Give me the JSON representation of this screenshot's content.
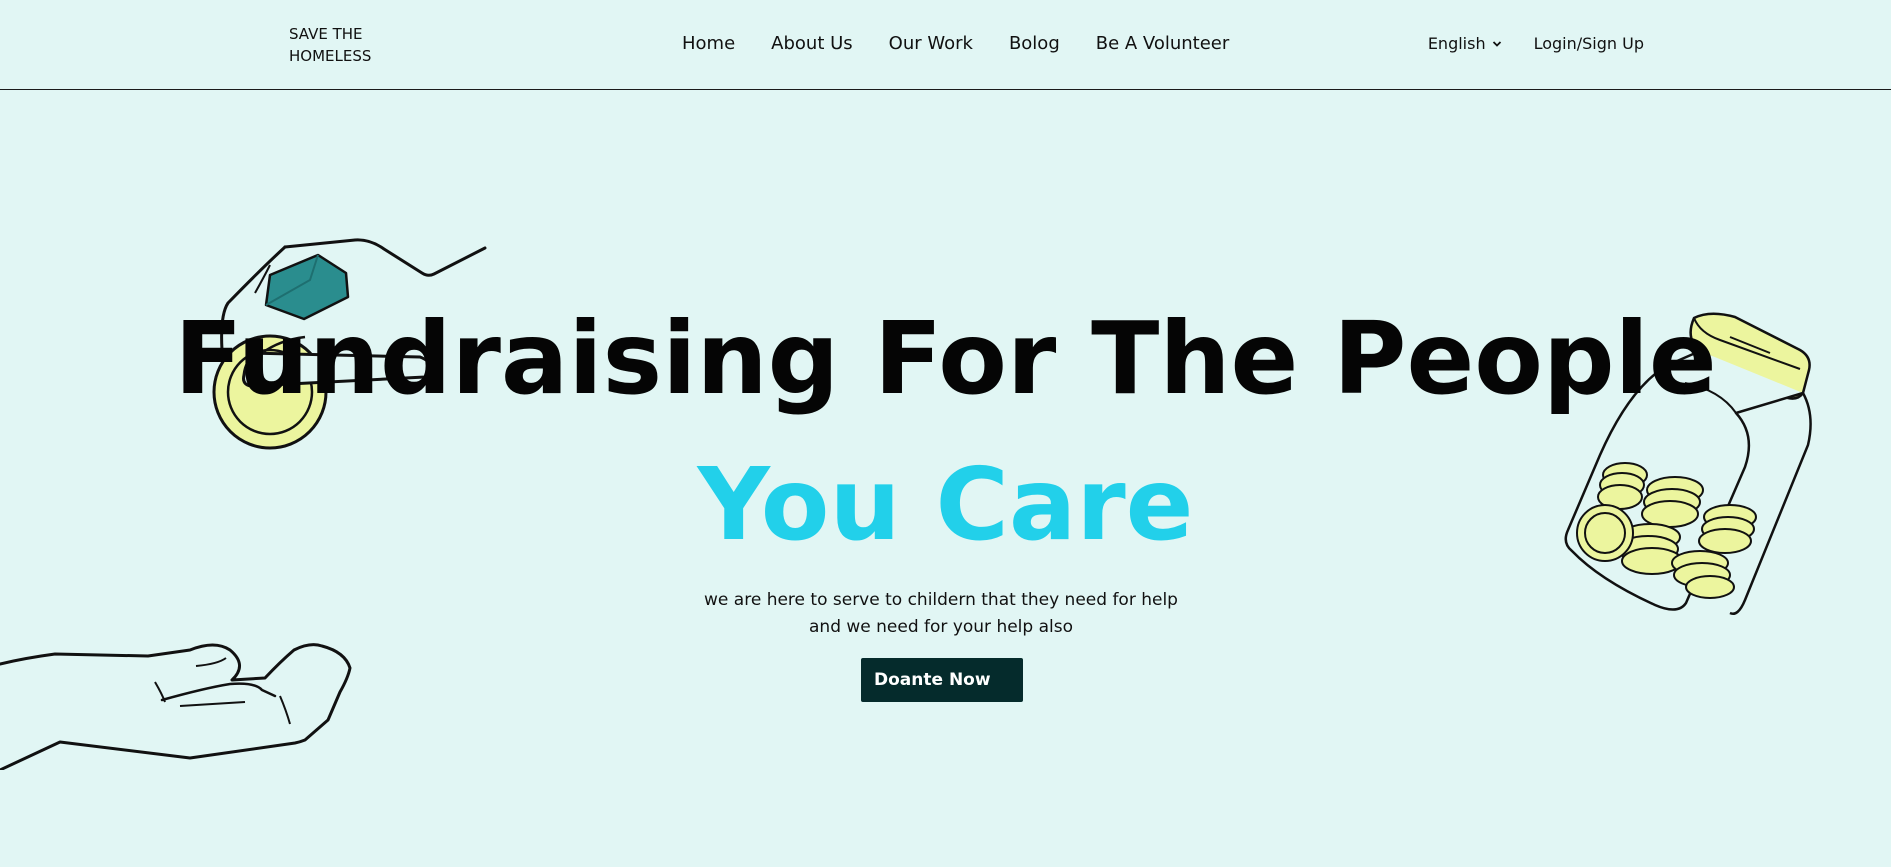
{
  "header": {
    "brand": "SAVE THE HOMELESS",
    "nav": [
      "Home",
      "About Us",
      "Our Work",
      "Bolog",
      "Be A Volunteer"
    ],
    "language": "English",
    "login": "Login/Sign Up"
  },
  "hero": {
    "title": "Fundraising For The People",
    "accent": "You Care",
    "subtitle": "we are here to serve to childern that they need for help and we need for your help also",
    "cta": "Doante Now"
  },
  "colors": {
    "background": "#e1f6f4",
    "accent": "#22d0ea",
    "button": "#052b2c",
    "coin": "#ecf59e",
    "gem": "#2a8d8e"
  },
  "icons": {
    "language_caret": "chevron-down-icon"
  }
}
